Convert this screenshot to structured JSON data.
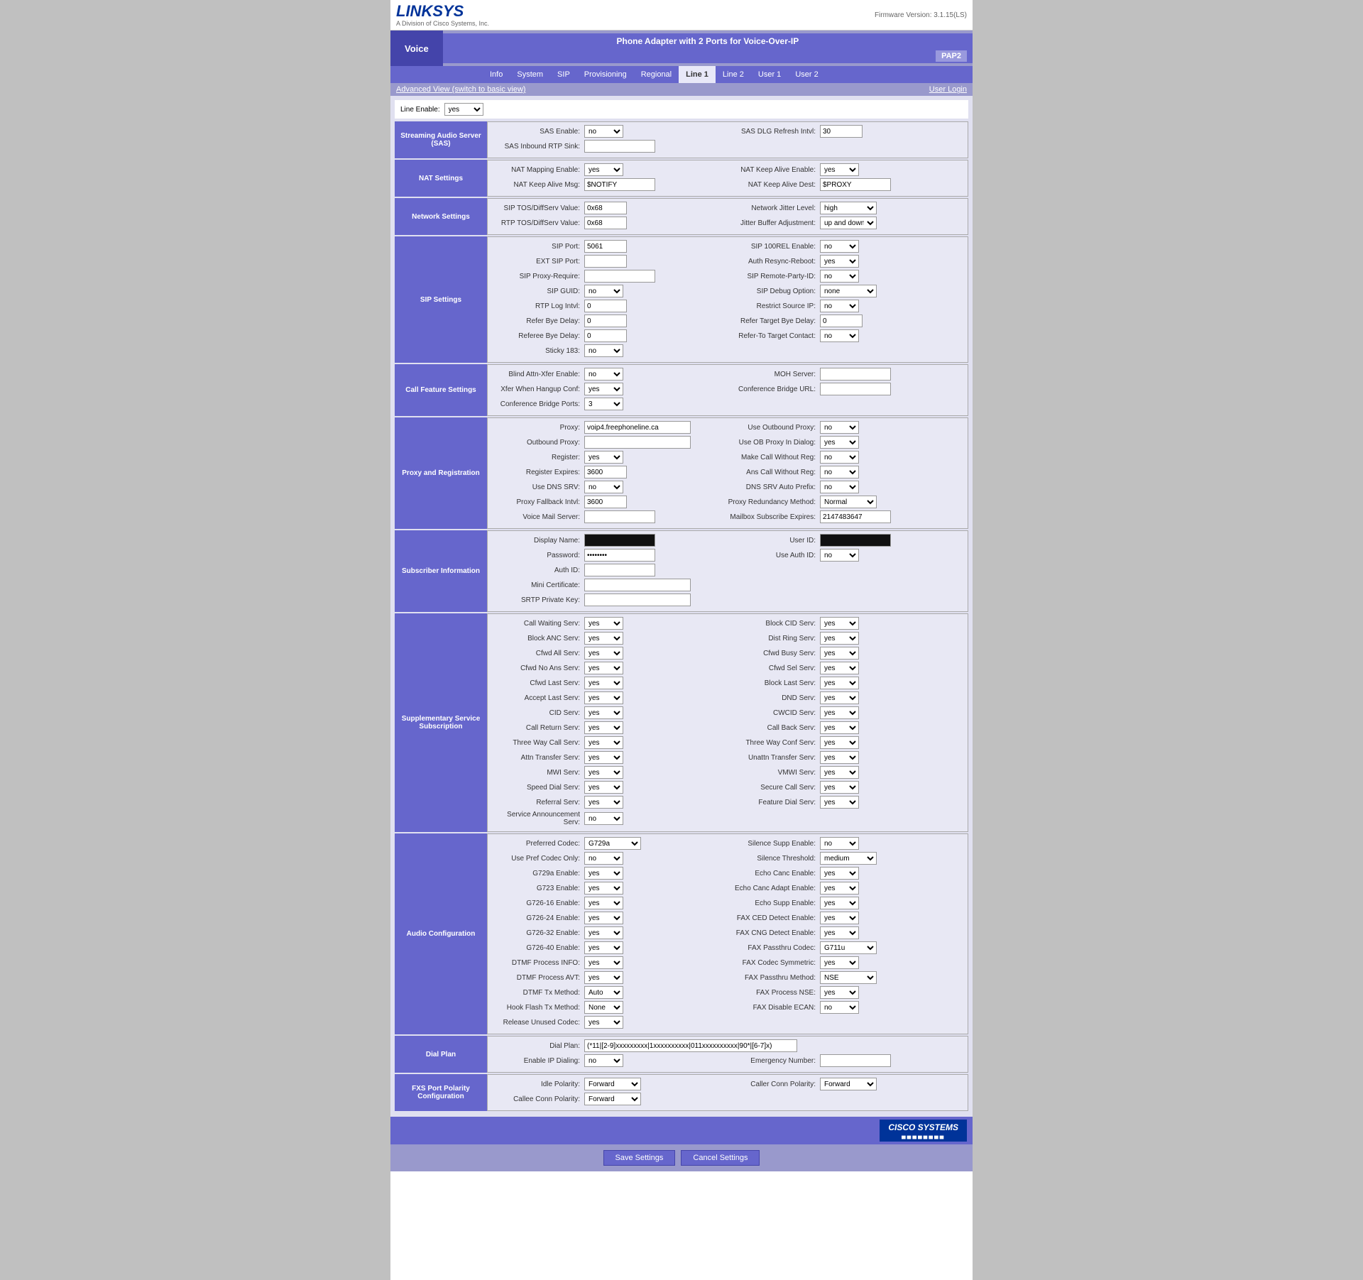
{
  "header": {
    "product": "Phone Adapter with 2 Ports for Voice-Over-IP",
    "model": "PAP2",
    "firmware": "Firmware Version: 3.1.15(LS)",
    "brand": "LINKSYS",
    "brand_sub": "A Division of Cisco Systems, Inc."
  },
  "nav": {
    "voice_label": "Voice",
    "tabs": [
      "Info",
      "System",
      "SIP",
      "Provisioning",
      "Regional",
      "Line 1",
      "Line 2",
      "User 1",
      "User 2"
    ],
    "active_tab": "Line 1",
    "advanced_view": "Advanced View (switch to basic view)",
    "user_login": "User Login"
  },
  "sections": {
    "line_enable": {
      "label": "Line Enable:",
      "value": "yes"
    },
    "sas": {
      "title": "Streaming Audio Server (SAS)",
      "sas_enable_label": "SAS Enable:",
      "sas_enable_value": "no",
      "sas_inbound_rtp_sink_label": "SAS Inbound RTP Sink:",
      "sas_dlg_refresh_intvl_label": "SAS DLG Refresh Intvl:",
      "sas_dlg_refresh_intvl_value": "30"
    },
    "nat": {
      "title": "NAT Settings",
      "nat_mapping_enable_label": "NAT Mapping Enable:",
      "nat_mapping_enable_value": "yes",
      "nat_keep_alive_msg_label": "NAT Keep Alive Msg:",
      "nat_keep_alive_msg_value": "$NOTIFY",
      "nat_keep_alive_enable_label": "NAT Keep Alive Enable:",
      "nat_keep_alive_enable_value": "yes",
      "nat_keep_alive_dest_label": "NAT Keep Alive Dest:",
      "nat_keep_alive_dest_value": "$PROXY"
    },
    "network": {
      "title": "Network Settings",
      "sip_tos_diffserv_label": "SIP TOS/DiffServ Value:",
      "sip_tos_value": "0x68",
      "rtp_tos_label": "RTP TOS/DiffServ Value:",
      "rtp_tos_value": "0x68",
      "network_jitter_label": "Network Jitter Level:",
      "network_jitter_value": "high",
      "jitter_buffer_label": "Jitter Buffer Adjustment:",
      "jitter_buffer_value": "up and down"
    },
    "sip": {
      "title": "SIP Settings",
      "sip_port_label": "SIP Port:",
      "sip_port_value": "5061",
      "ext_sip_port_label": "EXT SIP Port:",
      "sip_proxy_require_label": "SIP Proxy-Require:",
      "sip_guid_label": "SIP GUID:",
      "sip_guid_value": "no",
      "rtp_log_intvl_label": "RTP Log Intvl:",
      "rtp_log_intvl_value": "0",
      "refer_bye_delay_label": "Refer Bye Delay:",
      "refer_bye_delay_value": "0",
      "referee_bye_delay_label": "Referee Bye Delay:",
      "referee_bye_delay_value": "0",
      "sticky_183_label": "Sticky 183:",
      "sticky_183_value": "no",
      "sip_100rel_enable_label": "SIP 100REL Enable:",
      "sip_100rel_value": "no",
      "auth_resync_reboot_label": "Auth Resync-Reboot:",
      "auth_resync_value": "yes",
      "sip_remote_party_id_label": "SIP Remote-Party-ID:",
      "sip_remote_party_value": "no",
      "sip_debug_option_label": "SIP Debug Option:",
      "sip_debug_value": "none",
      "restrict_source_ip_label": "Restrict Source IP:",
      "restrict_source_value": "no",
      "refer_target_bye_delay_label": "Refer Target Bye Delay:",
      "refer_target_value": "0",
      "refer_to_target_label": "Refer-To Target Contact:",
      "refer_to_value": "no"
    },
    "call_feature": {
      "title": "Call Feature Settings",
      "blind_attn_xfer_label": "Blind Attn-Xfer Enable:",
      "blind_attn_value": "no",
      "xfer_when_hangup_conf_label": "Xfer When Hangup Conf:",
      "xfer_when_value": "yes",
      "conf_bridge_ports_label": "Conference Bridge Ports:",
      "conf_bridge_ports_value": "3",
      "moh_server_label": "MOH Server:",
      "conf_bridge_url_label": "Conference Bridge URL:"
    },
    "proxy": {
      "title": "Proxy and Registration",
      "proxy_label": "Proxy:",
      "proxy_value": "voip4.freephoneline.ca",
      "outbound_proxy_label": "Outbound Proxy:",
      "register_label": "Register:",
      "register_value": "yes",
      "register_expires_label": "Register Expires:",
      "register_expires_value": "3600",
      "use_dns_srv_label": "Use DNS SRV:",
      "use_dns_srv_value": "no",
      "proxy_fallback_intvl_label": "Proxy Fallback Intvl:",
      "proxy_fallback_value": "3600",
      "voice_mail_server_label": "Voice Mail Server:",
      "use_outbound_proxy_label": "Use Outbound Proxy:",
      "use_outbound_value": "no",
      "use_ob_proxy_in_dialog_label": "Use OB Proxy In Dialog:",
      "use_ob_value": "yes",
      "make_call_without_reg_label": "Make Call Without Reg:",
      "make_call_value": "no",
      "ans_call_without_reg_label": "Ans Call Without Reg:",
      "ans_call_value": "no",
      "dns_srv_auto_prefix_label": "DNS SRV Auto Prefix:",
      "dns_srv_value": "no",
      "proxy_redundancy_method_label": "Proxy Redundancy Method:",
      "proxy_redundancy_value": "Normal",
      "mailbox_subscribe_expires_label": "Mailbox Subscribe Expires:",
      "mailbox_subscribe_value": "2147483647"
    },
    "subscriber": {
      "title": "Subscriber Information",
      "display_name_label": "Display Name:",
      "user_id_label": "User ID:",
      "password_label": "Password:",
      "use_auth_id_label": "Use Auth ID:",
      "use_auth_value": "no",
      "auth_id_label": "Auth ID:",
      "mini_certificate_label": "Mini Certificate:",
      "srtp_private_key_label": "SRTP Private Key:"
    },
    "supplementary": {
      "title": "Supplementary Service Subscription",
      "call_waiting_label": "Call Waiting Serv:",
      "call_waiting_value": "yes",
      "block_anc_label": "Block ANC Serv:",
      "block_anc_value": "yes",
      "cfwd_all_label": "Cfwd All Serv:",
      "cfwd_all_value": "yes",
      "cfwd_no_ans_label": "Cfwd No Ans Serv:",
      "cfwd_no_ans_value": "yes",
      "cfwd_last_label": "Cfwd Last Serv:",
      "cfwd_last_value": "yes",
      "accept_last_label": "Accept Last Serv:",
      "accept_last_value": "yes",
      "cid_label": "CID Serv:",
      "cid_value": "yes",
      "call_return_label": "Call Return Serv:",
      "call_return_value": "yes",
      "three_way_call_label": "Three Way Call Serv:",
      "three_way_call_value": "yes",
      "attn_transfer_label": "Attn Transfer Serv:",
      "attn_transfer_value": "yes",
      "mwi_label": "MWI Serv:",
      "mwi_value": "yes",
      "speed_dial_label": "Speed Dial Serv:",
      "speed_dial_value": "yes",
      "referral_label": "Referral Serv:",
      "referral_value": "yes",
      "service_announce_label": "Service Announcement Serv:",
      "service_announce_value": "no",
      "block_cid_label": "Block CID Serv:",
      "block_cid_value": "yes",
      "dist_ring_label": "Dist Ring Serv:",
      "dist_ring_value": "yes",
      "cfwd_busy_label": "Cfwd Busy Serv:",
      "cfwd_busy_value": "yes",
      "cfwd_sel_label": "Cfwd Sel Serv:",
      "cfwd_sel_value": "yes",
      "block_last_label": "Block Last Serv:",
      "block_last_value": "yes",
      "dnd_label": "DND Serv:",
      "dnd_value": "yes",
      "cwcid_label": "CWCID Serv:",
      "cwcid_value": "yes",
      "call_back_label": "Call Back Serv:",
      "call_back_value": "yes",
      "three_way_conf_label": "Three Way Conf Serv:",
      "three_way_conf_value": "yes",
      "unattn_transfer_label": "Unattn Transfer Serv:",
      "unattn_transfer_value": "yes",
      "vmwi_label": "VMWI Serv:",
      "vmwi_value": "yes",
      "secure_call_label": "Secure Call Serv:",
      "secure_call_value": "yes",
      "feature_dial_label": "Feature Dial Serv:",
      "feature_dial_value": "yes"
    },
    "audio": {
      "title": "Audio Configuration",
      "preferred_codec_label": "Preferred Codec:",
      "preferred_codec_value": "G729a",
      "use_pref_codec_only_label": "Use Pref Codec Only:",
      "use_pref_codec_value": "no",
      "g729a_enable_label": "G729a Enable:",
      "g729a_value": "yes",
      "g723_enable_label": "G723 Enable:",
      "g723_value": "yes",
      "g726_16_label": "G726-16 Enable:",
      "g726_16_value": "yes",
      "g726_24_label": "G726-24 Enable:",
      "g726_24_value": "yes",
      "g726_32_label": "G726-32 Enable:",
      "g726_32_value": "yes",
      "g726_40_label": "G726-40 Enable:",
      "g726_40_value": "yes",
      "dtmf_process_info_label": "DTMF Process INFO:",
      "dtmf_process_info_value": "yes",
      "dtmf_process_avt_label": "DTMF Process AVT:",
      "dtmf_process_avt_value": "yes",
      "dtmf_tx_method_label": "DTMF Tx Method:",
      "dtmf_tx_value": "Auto",
      "hook_flash_tx_label": "Hook Flash Tx Method:",
      "hook_flash_value": "None",
      "release_unused_codec_label": "Release Unused Codec:",
      "release_unused_value": "yes",
      "silence_supp_label": "Silence Supp Enable:",
      "silence_supp_value": "no",
      "silence_threshold_label": "Silence Threshold:",
      "silence_threshold_value": "medium",
      "echo_canc_enable_label": "Echo Canc Enable:",
      "echo_canc_value": "yes",
      "echo_canc_adapt_label": "Echo Canc Adapt Enable:",
      "echo_canc_adapt_value": "yes",
      "echo_supp_enable_label": "Echo Supp Enable:",
      "echo_supp_value": "yes",
      "fax_ced_detect_label": "FAX CED Detect Enable:",
      "fax_ced_value": "yes",
      "fax_cng_detect_label": "FAX CNG Detect Enable:",
      "fax_cng_value": "yes",
      "fax_passthru_codec_label": "FAX Passthru Codec:",
      "fax_passthru_codec_value": "G711u",
      "fax_codec_symmetric_label": "FAX Codec Symmetric:",
      "fax_codec_symmetric_value": "yes",
      "fax_passthru_method_label": "FAX Passthru Method:",
      "fax_passthru_method_value": "NSE",
      "fax_process_nse_label": "FAX Process NSE:",
      "fax_process_nse_value": "yes",
      "fax_disable_ecan_label": "FAX Disable ECAN:",
      "fax_disable_ecan_value": "no"
    },
    "dial_plan": {
      "title": "Dial Plan",
      "dial_plan_label": "Dial Plan:",
      "dial_plan_value": "(*11|[2-9]xxxxxxxxx|1xxxxxxxxxx|011xxxxxxxxxx|90*|[6-7]x)",
      "enable_ip_dialing_label": "Enable IP Dialing:",
      "enable_ip_value": "no",
      "emergency_number_label": "Emergency Number:"
    },
    "fxs_port": {
      "title": "FXS Port Polarity Configuration",
      "idle_polarity_label": "Idle Polarity:",
      "idle_polarity_value": "Forward",
      "callee_conn_polarity_label": "Callee Conn Polarity:",
      "callee_conn_value": "Forward",
      "caller_conn_polarity_label": "Caller Conn Polarity:",
      "caller_conn_value": "Forward"
    }
  },
  "buttons": {
    "save": "Save Settings",
    "cancel": "Cancel Settings"
  }
}
